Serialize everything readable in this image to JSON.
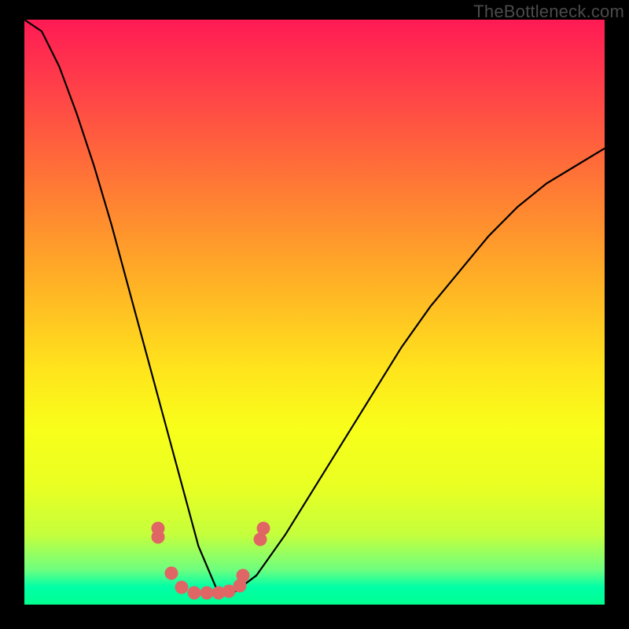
{
  "watermark": "TheBottleneck.com",
  "colors": {
    "frame": "#000000",
    "gradient_top": "#ff1a54",
    "gradient_bottom": "#00ff90",
    "curve": "#000000",
    "dot": "#e06666"
  },
  "chart_data": {
    "type": "line",
    "title": "",
    "xlabel": "",
    "ylabel": "",
    "xlim": [
      0,
      100
    ],
    "ylim": [
      0,
      100
    ],
    "curve": {
      "description": "V-shaped bottleneck curve",
      "minimum_x": 32,
      "x": [
        0,
        3,
        6,
        9,
        12,
        15,
        18,
        21,
        24,
        27,
        30,
        33,
        36,
        40,
        45,
        50,
        55,
        60,
        65,
        70,
        75,
        80,
        85,
        90,
        95,
        100
      ],
      "y": [
        100,
        98,
        92,
        84,
        75,
        65,
        54,
        43,
        32,
        21,
        10,
        3,
        2,
        5,
        12,
        20,
        28,
        36,
        44,
        51,
        57,
        63,
        68,
        72,
        75,
        78
      ]
    },
    "points": {
      "description": "Highlighted data points near the curve minimum",
      "x": [
        23.0,
        23.0,
        25.3,
        27.1,
        29.3,
        31.4,
        33.5,
        35.2,
        37.1,
        37.7,
        40.6,
        41.2
      ],
      "y": [
        13.0,
        11.5,
        5.4,
        3.0,
        2.0,
        2.0,
        2.0,
        2.3,
        3.2,
        5.0,
        11.2,
        13.0
      ]
    }
  }
}
